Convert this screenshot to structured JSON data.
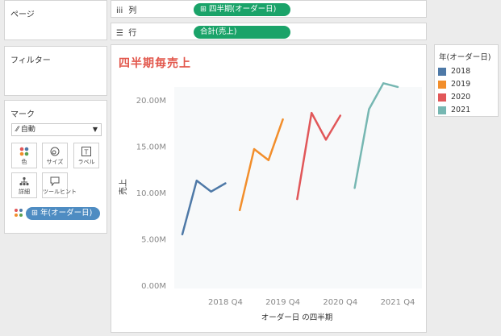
{
  "pages": {
    "title": "ページ"
  },
  "filters": {
    "title": "フィルター"
  },
  "marks": {
    "title": "マーク",
    "mark_type": "自動",
    "buttons": [
      {
        "label": "色",
        "icon": "color-dots-icon"
      },
      {
        "label": "サイズ",
        "icon": "size-icon"
      },
      {
        "label": "ラベル",
        "icon": "label-icon"
      },
      {
        "label": "詳細",
        "icon": "detail-icon"
      },
      {
        "label": "ツールヒント",
        "icon": "tooltip-icon"
      }
    ],
    "color_field": "⊞ 年(オーダー日)"
  },
  "shelves": {
    "columns": {
      "label": "列",
      "pill": "⊞ 四半期(オーダー日)"
    },
    "rows": {
      "label": "行",
      "pill": "合計(売上)"
    }
  },
  "legend": {
    "title": "年(オーダー日)",
    "items": [
      {
        "label": "2018",
        "color": "#4e79a7"
      },
      {
        "label": "2019",
        "color": "#f28e2b"
      },
      {
        "label": "2020",
        "color": "#e15759"
      },
      {
        "label": "2021",
        "color": "#76b7b2"
      }
    ]
  },
  "chart_data": {
    "type": "line",
    "title": "四半期毎売上",
    "xlabel": "オーダー日 の四半期",
    "ylabel": "売上",
    "y_ticks": [
      "0.00M",
      "5.00M",
      "10.00M",
      "15.00M",
      "20.00M"
    ],
    "ylim": [
      0,
      22000000
    ],
    "x_tick_labels": [
      "2018 Q4",
      "2019 Q4",
      "2020 Q4",
      "2021 Q4"
    ],
    "categories": [
      "2018 Q1",
      "2018 Q2",
      "2018 Q3",
      "2018 Q4",
      "2019 Q1",
      "2019 Q2",
      "2019 Q3",
      "2019 Q4",
      "2020 Q1",
      "2020 Q2",
      "2020 Q3",
      "2020 Q4",
      "2021 Q1",
      "2021 Q2",
      "2021 Q3",
      "2021 Q4"
    ],
    "series": [
      {
        "name": "2018",
        "color": "#4e79a7",
        "values": [
          5500000,
          11300000,
          10100000,
          11000000
        ]
      },
      {
        "name": "2019",
        "color": "#f28e2b",
        "values": [
          8100000,
          14700000,
          13500000,
          17900000
        ]
      },
      {
        "name": "2020",
        "color": "#e15759",
        "values": [
          9300000,
          18600000,
          15700000,
          18300000
        ]
      },
      {
        "name": "2021",
        "color": "#76b7b2",
        "values": [
          10500000,
          19000000,
          21800000,
          21400000
        ]
      }
    ],
    "grid": false,
    "legend_position": "right"
  }
}
